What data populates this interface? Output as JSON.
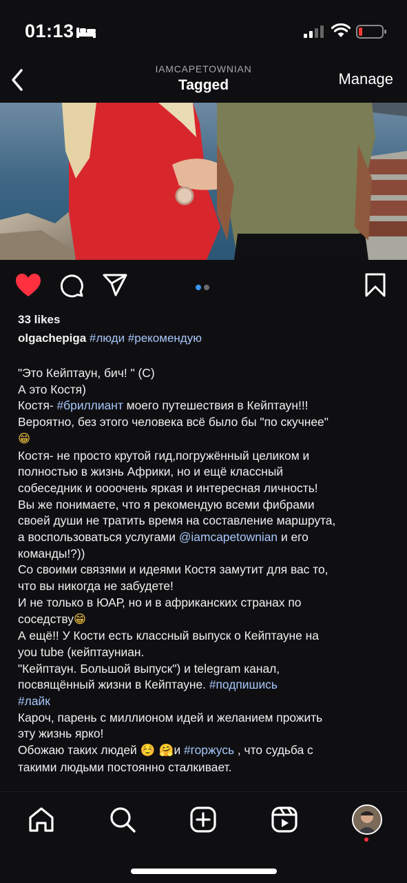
{
  "status": {
    "time": "01:13",
    "battery_color": "#ff3b30"
  },
  "nav": {
    "username": "IAMCAPETOWNIAN",
    "title": "Tagged",
    "manage": "Manage"
  },
  "post": {
    "likes": "33 likes",
    "author": "olgachepiga",
    "author_hashtags": "#люди #рекомендую",
    "carousel": {
      "count": 2,
      "active": 0
    },
    "caption_lines": [
      [
        {
          "t": "\"Это Кейптаун, бич! \" (С)"
        }
      ],
      [
        {
          "t": "А это Костя)"
        }
      ],
      [
        {
          "t": "Костя- "
        },
        {
          "t": "#бриллиант",
          "tag": true
        },
        {
          "t": " моего путешествия в Кейптаун!!!"
        }
      ],
      [
        {
          "t": "Вероятно, без этого человека всё было бы \"по скучнее\""
        }
      ],
      [
        {
          "t": "😁",
          "emoji": true
        }
      ],
      [
        {
          "t": "Костя- не просто крутой гид,погружённый целиком и"
        }
      ],
      [
        {
          "t": "полностью в жизнь Африки, но и ещё классный"
        }
      ],
      [
        {
          "t": "собеседник и оооочень яркая и интересная личность!"
        }
      ],
      [
        {
          "t": "Вы же понимаете, что я рекомендую всеми фибрами"
        }
      ],
      [
        {
          "t": "своей души не тратить  время на составление маршрута,"
        }
      ],
      [
        {
          "t": "а воспользоваться услугами  "
        },
        {
          "t": "@iamcapetownian",
          "tag": true
        },
        {
          "t": " и его"
        }
      ],
      [
        {
          "t": "команды!?))"
        }
      ],
      [
        {
          "t": "Со своими связями и идеями Костя замутит для вас то,"
        }
      ],
      [
        {
          "t": "что вы никогда не забудете!"
        }
      ],
      [
        {
          "t": "И не только в ЮАР, но и в африканских странах по"
        }
      ],
      [
        {
          "t": "соседству"
        },
        {
          "t": "😁",
          "emoji": true
        }
      ],
      [
        {
          "t": "А ещё!! У Кости есть классный  выпуск о Кейптауне  на"
        }
      ],
      [
        {
          "t": "you tube (кейптауниан."
        }
      ],
      [
        {
          "t": "\"Кейптаун. Большой выпуск\") и telegram канал,"
        }
      ],
      [
        {
          "t": "посвящённый жизни в Кейптауне. "
        },
        {
          "t": "#подпишись",
          "tag": true
        }
      ],
      [
        {
          "t": "#лайк",
          "tag": true
        }
      ],
      [
        {
          "t": "Кароч, парень с миллионом идей и желанием прожить"
        }
      ],
      [
        {
          "t": "эту жизнь ярко!"
        }
      ],
      [
        {
          "t": "Обожаю таких людей "
        },
        {
          "t": "☺️ 🤗",
          "emoji": true
        },
        {
          "t": "и "
        },
        {
          "t": "#горжусь",
          "tag": true
        },
        {
          "t": " , что судьба с"
        }
      ],
      [
        {
          "t": "такими людьми постоянно сталкивает."
        }
      ]
    ]
  },
  "colors": {
    "background": "#0f0f12",
    "heart": "#ff3040",
    "hashtag": "#a8c7fa",
    "active_dot": "#3897f0"
  },
  "icons": [
    "back-icon",
    "heart-icon",
    "comment-icon",
    "share-icon",
    "bookmark-icon",
    "home-icon",
    "search-icon",
    "create-icon",
    "reels-icon",
    "profile-avatar"
  ]
}
